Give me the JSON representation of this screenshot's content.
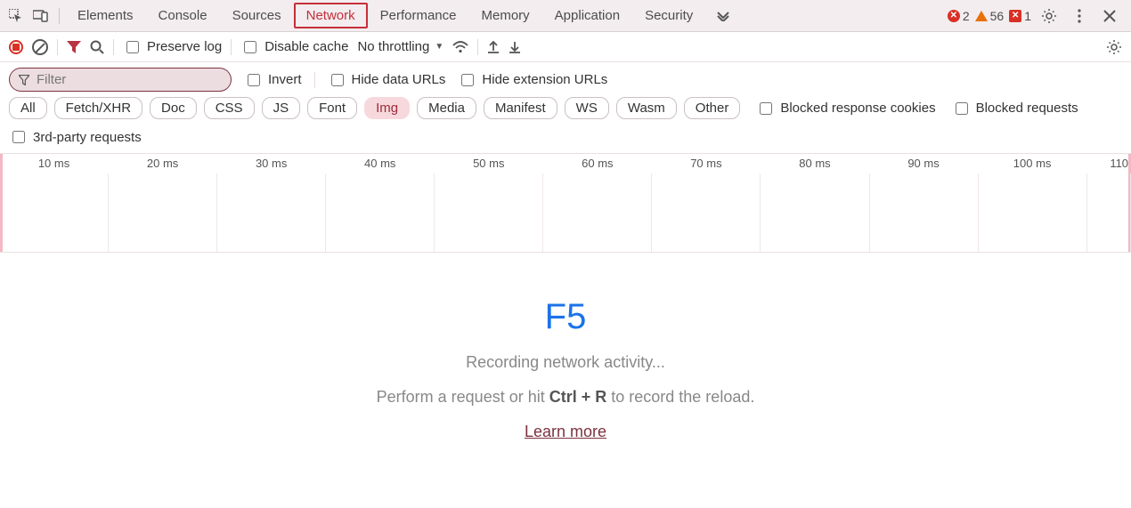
{
  "tabs": {
    "items": [
      "Elements",
      "Console",
      "Sources",
      "Network",
      "Performance",
      "Memory",
      "Application",
      "Security"
    ],
    "active": "Network"
  },
  "counters": {
    "errors": "2",
    "warnings": "56",
    "issues": "1"
  },
  "toolbar": {
    "preserve_log": "Preserve log",
    "disable_cache": "Disable cache",
    "throttling": "No throttling"
  },
  "filter": {
    "placeholder": "Filter",
    "invert": "Invert",
    "hide_data_urls": "Hide data URLs",
    "hide_ext_urls": "Hide extension URLs"
  },
  "chips": [
    "All",
    "Fetch/XHR",
    "Doc",
    "CSS",
    "JS",
    "Font",
    "Img",
    "Media",
    "Manifest",
    "WS",
    "Wasm",
    "Other"
  ],
  "chips_selected": "Img",
  "extra_checks": {
    "blocked_resp_cookies": "Blocked response cookies",
    "blocked_requests": "Blocked requests",
    "third_party": "3rd-party requests"
  },
  "timeline_ticks": [
    "10 ms",
    "20 ms",
    "30 ms",
    "40 ms",
    "50 ms",
    "60 ms",
    "70 ms",
    "80 ms",
    "90 ms",
    "100 ms",
    "110"
  ],
  "empty": {
    "shortcut": "F5",
    "line1": "Recording network activity...",
    "line2_pre": "Perform a request or hit ",
    "line2_kbd": "Ctrl + R",
    "line2_post": " to record the reload.",
    "learn_more": "Learn more"
  }
}
